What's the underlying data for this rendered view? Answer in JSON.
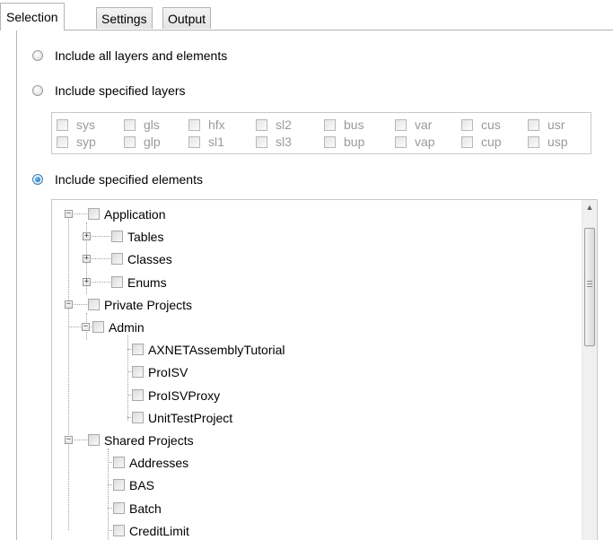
{
  "tabs": [
    {
      "label": "Selection",
      "active": true
    },
    {
      "label": "Settings",
      "active": false
    },
    {
      "label": "Output",
      "active": false
    }
  ],
  "options": {
    "all_layers": {
      "label": "Include all layers and elements",
      "checked": false
    },
    "specified_layers": {
      "label": "Include specified layers",
      "checked": false
    },
    "specified_elements": {
      "label": "Include specified elements",
      "checked": true
    }
  },
  "layers": [
    [
      "sys",
      "gls",
      "hfx",
      "sl2",
      "bus",
      "var",
      "cus",
      "usr"
    ],
    [
      "syp",
      "glp",
      "sl1",
      "sl3",
      "bup",
      "vap",
      "cup",
      "usp"
    ]
  ],
  "tree": [
    {
      "label": "Application",
      "level": 0,
      "expander": "minus"
    },
    {
      "label": "Tables",
      "level": 1,
      "expander": "plus"
    },
    {
      "label": "Classes",
      "level": 1,
      "expander": "plus"
    },
    {
      "label": "Enums",
      "level": 1,
      "expander": "plus"
    },
    {
      "label": "Private Projects",
      "level": 0,
      "expander": "minus"
    },
    {
      "label": "Admin",
      "level": 1,
      "expander": "minus"
    },
    {
      "label": "AXNETAssemblyTutorial",
      "level": 2,
      "expander": "none"
    },
    {
      "label": "ProISV",
      "level": 2,
      "expander": "none"
    },
    {
      "label": "ProISVProxy",
      "level": 2,
      "expander": "none"
    },
    {
      "label": "UnitTestProject",
      "level": 2,
      "expander": "none"
    },
    {
      "label": "Shared Projects",
      "level": 0,
      "expander": "minus"
    },
    {
      "label": "Addresses",
      "level": 1,
      "expander": "none"
    },
    {
      "label": "BAS",
      "level": 1,
      "expander": "none"
    },
    {
      "label": "Batch",
      "level": 1,
      "expander": "none"
    },
    {
      "label": "CreditLimit",
      "level": 1,
      "expander": "none"
    }
  ],
  "scrollbar": {
    "up_icon": "▲",
    "down_icon": "▼"
  }
}
